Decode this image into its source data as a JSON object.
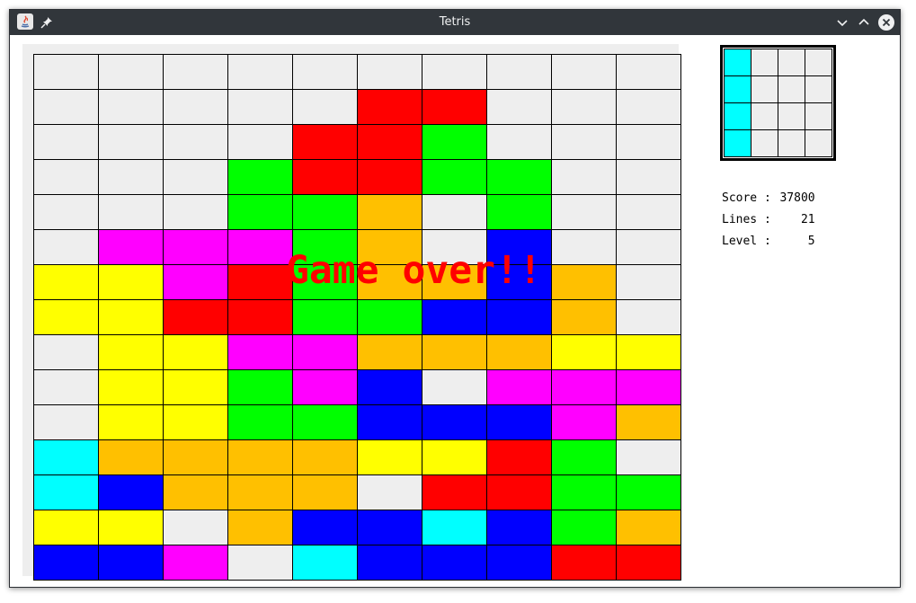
{
  "window": {
    "title": "Tetris"
  },
  "palette": {
    "E": "#eeeeee",
    "R": "#ff0000",
    "G": "#00ff00",
    "B": "#0000ff",
    "Y": "#ffff00",
    "M": "#ff00ff",
    "O": "#ffc000",
    "C": "#00ffff"
  },
  "board": {
    "rows": [
      "EEEEEEEEEE",
      "EEEEERFEEE",
      "EEEERRGEEE",
      "EEEGRFGGEE",
      "EEEGGOEGEE",
      "EMMMGOEBEE",
      "YYMRGOOBOE",
      "YYRRGGBBOE",
      "EYYMMOOOYY",
      "EYYGMBEMMM",
      "EYYGGBBBMO",
      "COOOOYYRGE",
      "CBOOOERRGG",
      "YYEOBBCBGO",
      "BBMECBBBRR"
    ]
  },
  "message": {
    "game_over": "Game over!!"
  },
  "next_piece": {
    "rows": [
      "CEEE",
      "CEEE",
      "CEEE",
      "CEEE"
    ]
  },
  "stats": {
    "score_label": "Score :",
    "score": "37800",
    "lines_label": "Lines :",
    "lines": "21",
    "level_label": "Level :",
    "level": "5"
  }
}
